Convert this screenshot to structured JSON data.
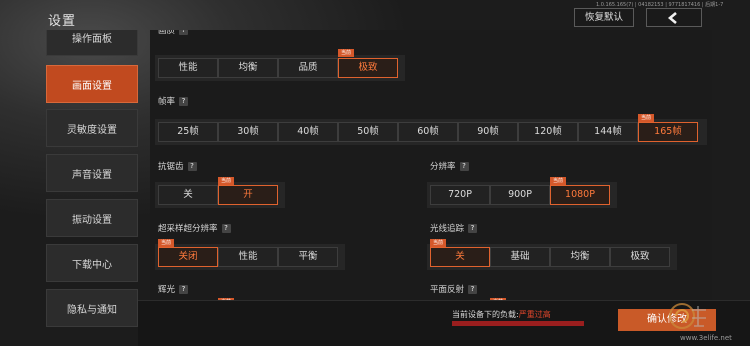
{
  "app": {
    "title": "设置",
    "build": "1.0.165.165(7) | 04182153 | 9771817416 | 后期1-7",
    "reset_label": "恢复默认",
    "back_icon": "chevron-left-icon"
  },
  "sidebar": {
    "items": [
      {
        "label": "操作面板"
      },
      {
        "label": "画面设置",
        "active": true
      },
      {
        "label": "灵敏度设置"
      },
      {
        "label": "声音设置"
      },
      {
        "label": "振动设置"
      },
      {
        "label": "下载中心"
      },
      {
        "label": "隐私与通知"
      }
    ]
  },
  "badge_text": "当前",
  "sections": {
    "quality": {
      "label": "画质",
      "options": [
        "性能",
        "均衡",
        "品质",
        "极致"
      ],
      "selected": "极致",
      "current": "极致"
    },
    "framerate": {
      "label": "帧率",
      "options": [
        "25帧",
        "30帧",
        "40帧",
        "50帧",
        "60帧",
        "90帧",
        "120帧",
        "144帧",
        "165帧"
      ],
      "selected": "165帧",
      "current": "165帧"
    },
    "antialias": {
      "label": "抗锯齿",
      "options": [
        "关",
        "开"
      ],
      "selected": "开",
      "current": "开"
    },
    "resolution": {
      "label": "分辨率",
      "options": [
        "720P",
        "900P",
        "1080P"
      ],
      "selected": "1080P",
      "current": "1080P"
    },
    "supersampling": {
      "label": "超采样超分辨率",
      "options": [
        "关闭",
        "性能",
        "平衡"
      ],
      "selected": "关闭",
      "current": "关闭"
    },
    "raytracing": {
      "label": "光线追踪",
      "options": [
        "关",
        "基础",
        "均衡",
        "极致"
      ],
      "selected": "关",
      "current": "关"
    },
    "bloom": {
      "label": "辉光"
    },
    "reflection": {
      "label": "平面反射"
    }
  },
  "footer": {
    "load_label": "当前设备下的负载:",
    "load_value": "严重过高",
    "load_level": 1.0,
    "confirm_label": "确认修改"
  },
  "watermark": {
    "site": "www.3elife.net"
  },
  "colors": {
    "accent": "#d5582a",
    "selected_text": "#ff7a3c",
    "load_bar": "#9a1e1e"
  }
}
